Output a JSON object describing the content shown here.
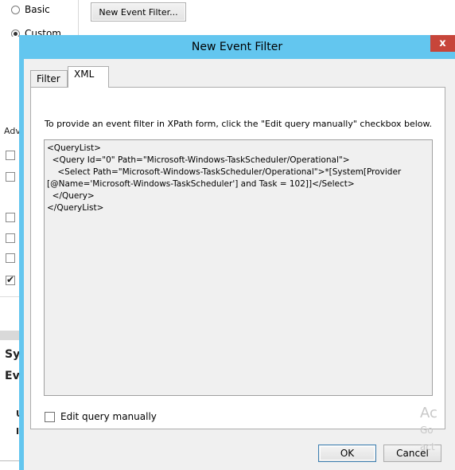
{
  "background": {
    "radio_basic_label": "Basic",
    "radio_custom_label": "Custom",
    "new_event_filter_button": "New Event Filter...",
    "adv_label": "Adv",
    "frag_sy": "Sy",
    "frag_ev": "Ev",
    "frag_u": "U",
    "frag_i": "I"
  },
  "dialog": {
    "title": "New Event Filter",
    "close_glyph": "x",
    "tabs": [
      {
        "label": "Filter",
        "selected": false
      },
      {
        "label": "XML",
        "selected": true
      }
    ],
    "instructions": "To provide an event filter in XPath form, click the \"Edit query manually\" checkbox below.",
    "xml_query": "<QueryList>\n  <Query Id=\"0\" Path=\"Microsoft-Windows-TaskScheduler/Operational\">\n    <Select Path=\"Microsoft-Windows-TaskScheduler/Operational\">*[System[Provider\n[@Name='Microsoft-Windows-TaskScheduler'] and Task = 102]]</Select>\n  </Query>\n</QueryList>",
    "edit_query_label": "Edit query manually",
    "edit_query_checked": false,
    "ok_label": "OK",
    "cancel_label": "Cancel"
  },
  "watermark": {
    "line1": "Ac",
    "line2": "Go",
    "line3": "act"
  },
  "colors": {
    "title_bar": "#63c6ef",
    "close_button": "#c7453a",
    "client": "#f0f0f0"
  }
}
